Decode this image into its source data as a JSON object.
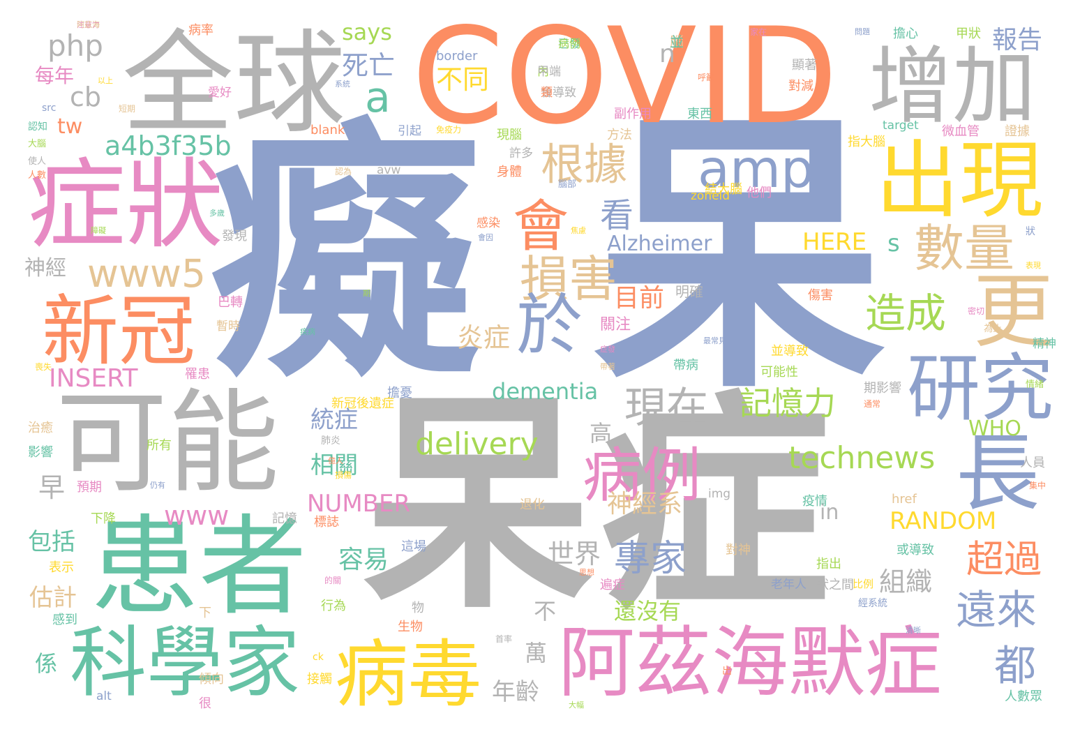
{
  "palette": {
    "blue": "#8da0cb",
    "gray": "#b3b3b3",
    "orange": "#fc8d62",
    "green": "#66c2a5",
    "pink": "#e78ac3",
    "lime": "#a6d854",
    "yellow": "#ffd92f",
    "tan": "#e5c494"
  },
  "words": {
    "chi": "癡",
    "dai": "呆",
    "zheng": "症",
    "covid": "COVID",
    "quanqiu": "全球",
    "zengjia": "增加",
    "zhengzhuang": "症狀",
    "chuxian": "出現",
    "huanzhe": "患者",
    "kexuejia": "科學家",
    "kenen": "可能",
    "xinguan": "新冠",
    "bingdu": "病毒",
    "azhm": "阿茲海默症",
    "yanjiu": "研究",
    "geng": "更",
    "chang": "長",
    "amp": "amp",
    "hui": "會",
    "shuliang": "數量",
    "sunhai": "損害",
    "yu": "於",
    "bingli": "病例",
    "www5": "www5",
    "genju": "根據",
    "zaocheng": "造成",
    "xianzai": "現在",
    "zhuanjia": "專家",
    "delivery": "delivery",
    "technews": "technews",
    "jiyili": "記憶力",
    "chaoguo": "超過",
    "yuanlai": "遠來",
    "dou": "都",
    "a4b": "a4b3f35b",
    "php": "php",
    "cb": "cb",
    "tw": "tw",
    "a": "a",
    "siwang": "死亡",
    "butong": "不同",
    "baogao": "報告",
    "says": "says",
    "n": "n",
    "kan": "看",
    "alzheimer": "Alzheimer",
    "here": "HERE",
    "s": "s",
    "mubiao": "目前",
    "yanzheng": "炎症",
    "insert": "INSERT",
    "dementia": "dementia",
    "tongzheng": "統症",
    "xiangguan": "相關",
    "number": "NUMBER",
    "www": "www",
    "random": "RANDOM",
    "shenjingxi": "神經系",
    "rongyi": "容易",
    "shijie": "世界",
    "bu": "不",
    "wan": "萬",
    "nianling": "年齡",
    "zuzhi": "組織",
    "huanmeiyou": "還沒有",
    "gao": "高",
    "zao": "早",
    "baokuo": "包括",
    "guji": "估計",
    "xi": "係",
    "shenjing": "神經",
    "meinian": "每年",
    "bingl": "病率",
    "guanzhu": "關注",
    "who": "WHO",
    "in": "in",
    "border": "border",
    "blank": "blank",
    "target": "target",
    "zoneid": "zoneid",
    "avw": "avw",
    "img": "img",
    "href": "href",
    "alt": "alt",
    "src": "src",
    "ck": "ck",
    "small": [
      "注意力",
      "腦",
      "已發",
      "內",
      "會導致",
      "呼籲",
      "系統",
      "以上",
      "愛好",
      "短期",
      "認知",
      "大腦",
      "使人",
      "人數",
      "引起",
      "免疫力",
      "副作用",
      "方法",
      "東西",
      "現腦",
      "許多",
      "身體",
      "腦部",
      "結大腦",
      "他們",
      "認為",
      "多歲",
      "障礙",
      "發現",
      "感染",
      "會因",
      "焦慮",
      "巴轉",
      "暫時",
      "疾病",
      "期",
      "明確",
      "傷害",
      "最常見",
      "並導致",
      "症發",
      "帶著",
      "帶病",
      "可能性",
      "期影響",
      "通常",
      "擔憂",
      "新冠後遺症",
      "罹患",
      "治癒",
      "影響",
      "所有",
      "肺炎",
      "億人",
      "仍有",
      "損傷",
      "預期",
      "退化",
      "疫情",
      "下降",
      "記憶",
      "標誌",
      "這場",
      "表示",
      "的關",
      "對神",
      "或導致",
      "指出",
      "狀之間",
      "思想",
      "老年人",
      "比例",
      "遍症",
      "下",
      "感到",
      "行為",
      "物",
      "生物",
      "經系統",
      "指大腦",
      "微血管",
      "證據",
      "擔心",
      "甲狀",
      "顯著",
      "對減",
      "狀",
      "表現",
      "密切",
      "為止",
      "精神",
      "情緒",
      "人員",
      "集中",
      "清晰",
      "接觸",
      "很",
      "傾向",
      "人數眾",
      "大幅",
      "首率",
      "出",
      "問題",
      "喪失",
      "家在",
      "阿茲海",
      "並",
      "病例",
      "甲端",
      "類"
    ]
  }
}
